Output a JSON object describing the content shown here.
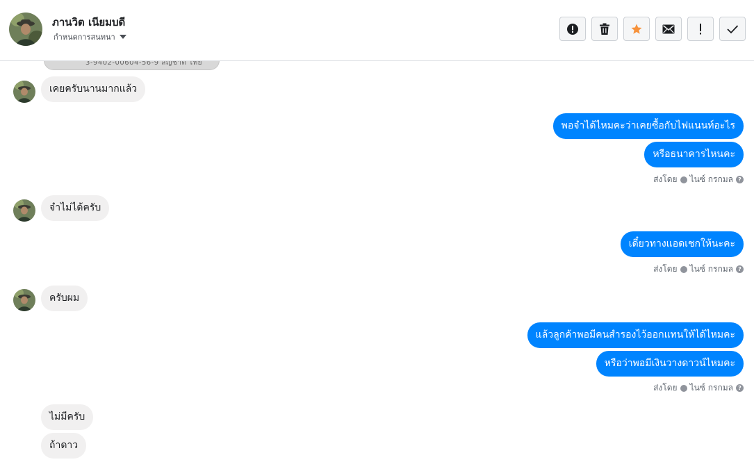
{
  "header": {
    "name": "ภานวิต เนียมบดี",
    "subtitle": "กำหนดการสนทนา"
  },
  "actions": [
    {
      "icon": "alert-circle-icon"
    },
    {
      "icon": "trash-icon"
    },
    {
      "icon": "star-icon",
      "color": "#f7923b"
    },
    {
      "icon": "envelope-icon"
    },
    {
      "icon": "exclamation-icon"
    },
    {
      "icon": "checkmark-icon"
    }
  ],
  "thread": {
    "id_card_text": "3-9402-00604-56-9 สัญชาติ ไทย",
    "messages": [
      {
        "dir": "in",
        "text": "เคยครับนานมากแล้ว"
      },
      {
        "dir": "out",
        "text": "พอจำได้ไหมคะว่าเคยซื้อกับไฟแนนท์อะไร"
      },
      {
        "dir": "out",
        "text": "หรือธนาคารไหนคะ"
      },
      {
        "dir": "in",
        "text": "จำไม่ได้ครับ"
      },
      {
        "dir": "out",
        "text": "เดี๋ยวทางแอดเชกให้นะคะ"
      },
      {
        "dir": "in",
        "text": "ครับผม"
      },
      {
        "dir": "out",
        "text": "แล้วลูกค้าพอมีคนสำรองไว้ออกแทนให้ได้ไหมคะ"
      },
      {
        "dir": "out",
        "text": "หรือว่าพอมีเงินวางดาวน์ไหมคะ"
      },
      {
        "dir": "in",
        "text": "ไม่มีครับ"
      },
      {
        "dir": "in",
        "text": "ถ้าดาว"
      }
    ],
    "sent_by": {
      "label": "ส่งโดย",
      "author": "ไนซ์ กรกมล",
      "help": "?"
    }
  },
  "colors": {
    "outgoing": "#0084ff",
    "incoming": "#f1f0f0",
    "accent_star": "#f7923b"
  }
}
